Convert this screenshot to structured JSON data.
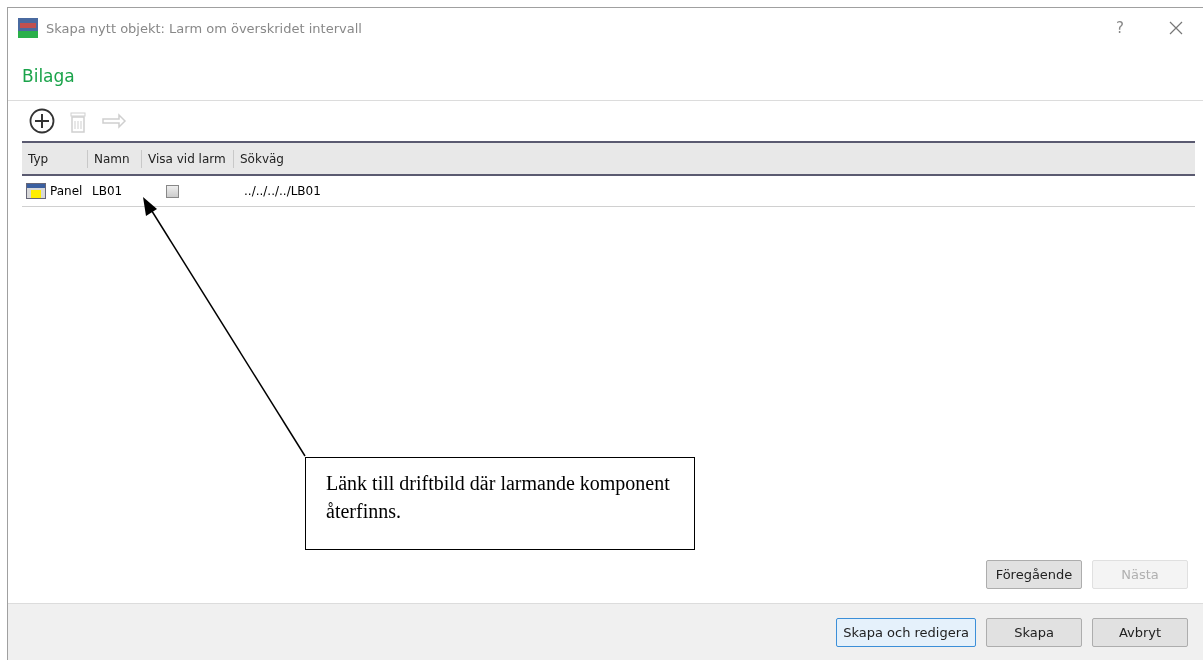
{
  "window": {
    "title": "Skapa nytt objekt: Larm om överskridet intervall",
    "help": "?"
  },
  "section_title": "Bilaga",
  "toolbar": [
    {
      "kind": "add",
      "disabled": false
    },
    {
      "kind": "delete",
      "disabled": true
    },
    {
      "kind": "link",
      "disabled": true
    }
  ],
  "table": {
    "columns": [
      "Typ",
      "Namn",
      "Visa vid larm",
      "Sökväg"
    ],
    "rows": [
      {
        "type": "Panel",
        "name": "LB01",
        "show_on_alarm": false,
        "path": "../../../../LB01"
      }
    ]
  },
  "annotation": {
    "text": "Länk till driftbild där larmande komponent återfinns."
  },
  "nav_buttons": [
    {
      "label": "Föregående",
      "disabled": false
    },
    {
      "label": "Nästa",
      "disabled": true
    }
  ],
  "footer_buttons": [
    {
      "label": "Skapa och redigera",
      "default": true
    },
    {
      "label": "Skapa",
      "default": false
    },
    {
      "label": "Avbryt",
      "default": false
    }
  ]
}
